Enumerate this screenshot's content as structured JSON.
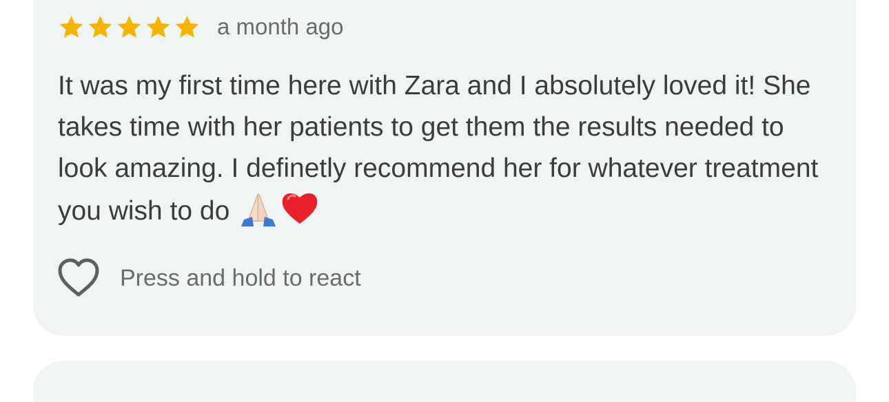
{
  "review": {
    "rating": 5,
    "rating_max": 5,
    "star_color": "#f5b400",
    "date": "a month ago",
    "text": "It was my first time here with Zara and I absolutely loved it! She takes time with her patients to get them the results needed to look amazing. I definetly recommend her for whatever treatment you wish to do",
    "emojis": [
      "folded-hands-emoji",
      "red-heart-emoji"
    ]
  },
  "reaction": {
    "icon": "heart-outline-icon",
    "label": "Press and hold to react"
  },
  "colors": {
    "card_background": "#f1f4f5",
    "text_primary": "#3c3c3c",
    "text_secondary": "#6b6b6b"
  }
}
